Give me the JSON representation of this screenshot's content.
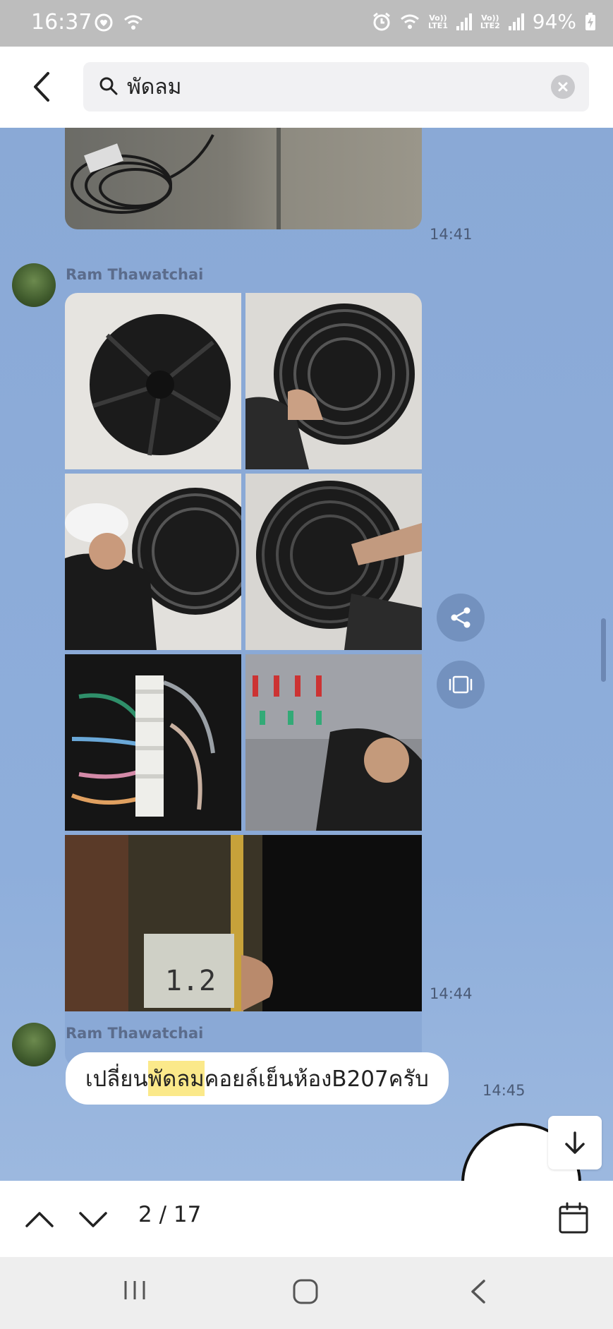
{
  "status_bar": {
    "time": "16:37",
    "network_1": "LTE1",
    "network_2": "LTE2",
    "vo_label": "Vo))",
    "battery": "94%"
  },
  "search": {
    "query": "พัดลม"
  },
  "messages": [
    {
      "type": "image",
      "timestamp": "14:41"
    },
    {
      "type": "image-album",
      "sender": "Ram Thawatchai",
      "timestamp": "14:44",
      "image_count": 7
    },
    {
      "type": "text",
      "sender": "Ram Thawatchai",
      "text_before": "เปลี่ยน",
      "text_match": "พัดลม",
      "text_after": "คอยล์เย็นห้องB207ครับ",
      "timestamp": "14:45"
    }
  ],
  "result_nav": {
    "counter": "2 / 17"
  },
  "colors": {
    "chat_background": "#8aa9d6",
    "highlight": "#fbe98a"
  },
  "icons": [
    "back-arrow-icon",
    "search-icon",
    "clear-icon",
    "share-icon",
    "carousel-icon",
    "arrow-down-icon",
    "chevron-up-icon",
    "chevron-down-icon",
    "calendar-icon",
    "recent-apps-icon",
    "home-icon",
    "system-back-icon"
  ]
}
